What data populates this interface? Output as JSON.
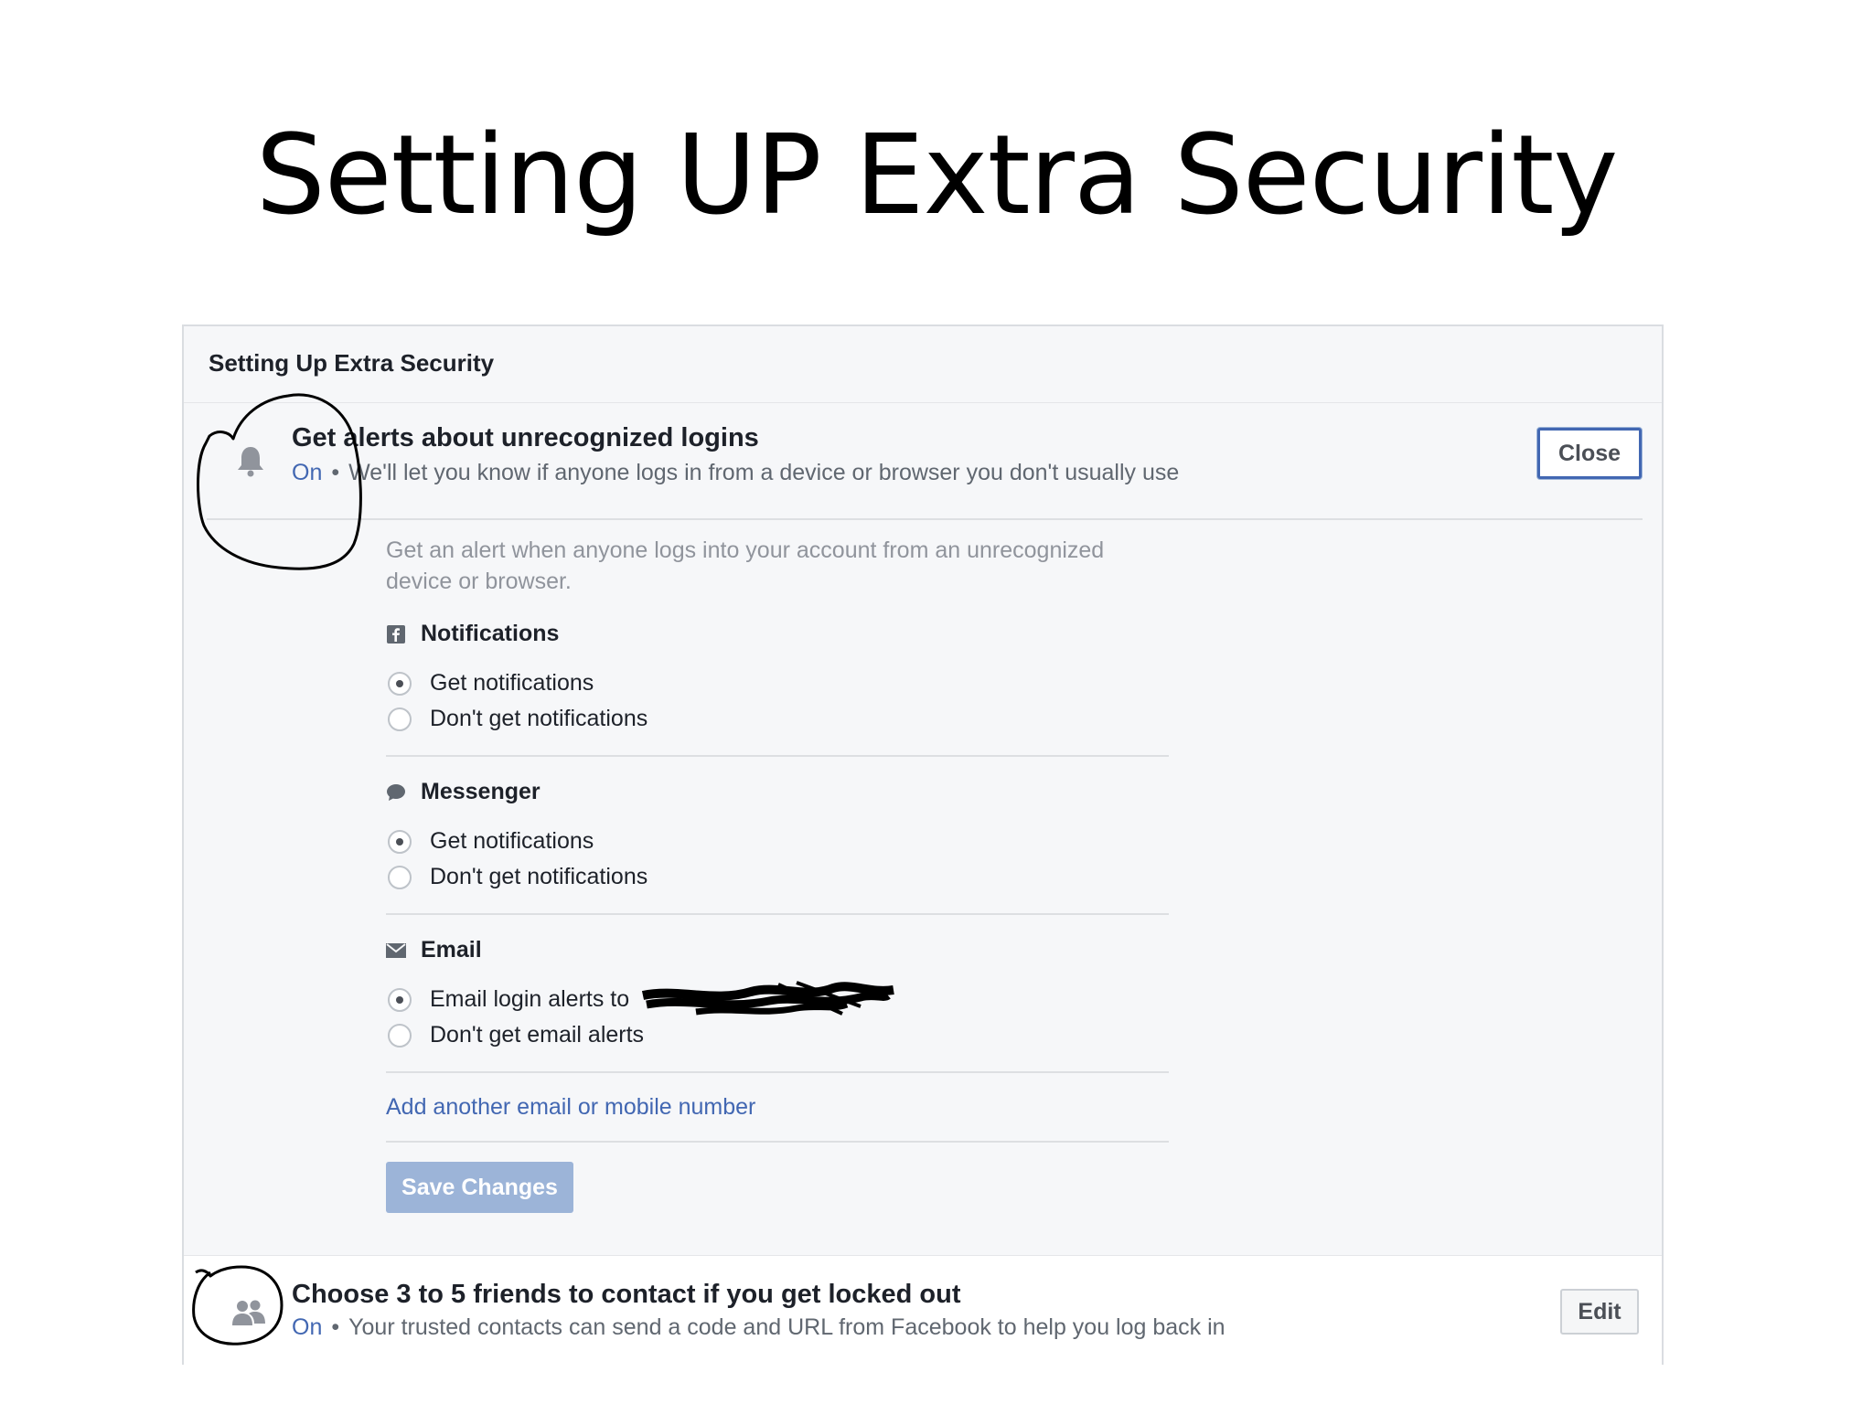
{
  "slide": {
    "title": "Setting UP Extra Security"
  },
  "panel": {
    "title": "Setting Up Extra Security",
    "alerts": {
      "title": "Get alerts about unrecognized logins",
      "status": "On",
      "separator": "•",
      "summary": "We'll let you know if anyone logs in from a device or browser you don't usually use",
      "close_label": "Close",
      "description": "Get an alert when anyone logs into your account from an unrecognized device or browser.",
      "sections": {
        "notifications": {
          "heading": "Notifications",
          "icon": "facebook-icon",
          "options": [
            "Get notifications",
            "Don't get notifications"
          ],
          "selected": 0
        },
        "messenger": {
          "heading": "Messenger",
          "icon": "messenger-icon",
          "options": [
            "Get notifications",
            "Don't get notifications"
          ],
          "selected": 0
        },
        "email": {
          "heading": "Email",
          "icon": "envelope-icon",
          "options": [
            "Email login alerts to",
            "Don't get email alerts"
          ],
          "selected": 0
        }
      },
      "add_contact_link": "Add another email or mobile number",
      "save_label": "Save Changes"
    },
    "trusted_contacts": {
      "title": "Choose 3 to 5 friends to contact if you get locked out",
      "status": "On",
      "separator": "•",
      "summary": "Your trusted contacts can send a code and URL from Facebook to help you log back in",
      "edit_label": "Edit"
    }
  },
  "colors": {
    "link_blue": "#4267b2",
    "save_button": "#9cb4d8",
    "panel_background": "#f6f7f9"
  }
}
